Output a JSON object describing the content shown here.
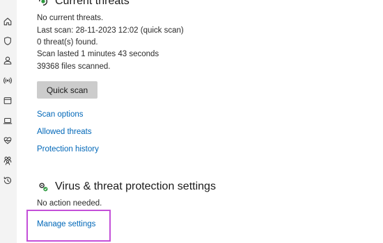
{
  "nav": {
    "icons": [
      "home-icon",
      "shield-icon",
      "person-icon",
      "wifi-icon",
      "app-browser-icon",
      "laptop-icon",
      "heart-icon",
      "family-icon",
      "history-icon"
    ]
  },
  "threats": {
    "title": "Current threats",
    "lines": [
      "No current threats.",
      "Last scan: 28-11-2023 12:02 (quick scan)",
      "0 threat(s) found.",
      "Scan lasted 1 minutes 43 seconds",
      "39368 files scanned."
    ],
    "quick_scan_label": "Quick scan",
    "links": [
      "Scan options",
      "Allowed threats",
      "Protection history"
    ]
  },
  "settings": {
    "title": "Virus & threat protection settings",
    "status": "No action needed.",
    "manage_label": "Manage settings"
  },
  "colors": {
    "link": "#0067b8",
    "highlight": "#c34fd8",
    "button": "#cccccc"
  }
}
